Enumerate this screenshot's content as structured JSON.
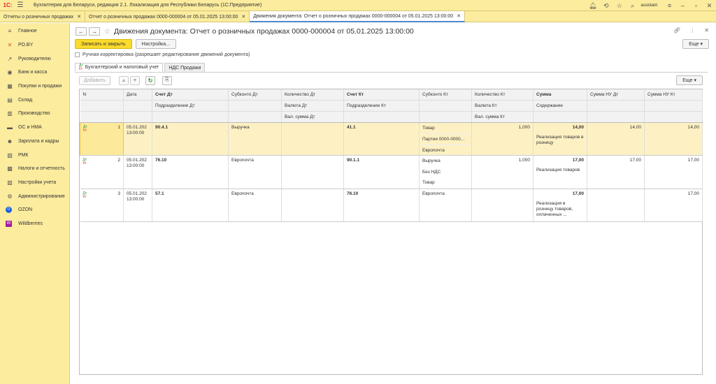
{
  "app": {
    "logo": "1С:",
    "title": "Бухгалтерия для Беларуси, редакция 2.1. Локализация для Республики Беларусь  (1С:Предприятие)",
    "user": "assistant"
  },
  "window_tabs": [
    {
      "label": "Отчеты о розничных продажах"
    },
    {
      "label": "Отчет о розничных продажах 0000-000004 от 05.01.2025 13:00:00"
    },
    {
      "label": "Движения документа: Отчет о розничных продажах 0000-000004 от 05.01.2025 13:00:00"
    }
  ],
  "sidebar": {
    "items": [
      {
        "label": "Главное",
        "icon": "≡"
      },
      {
        "label": "РО.BY",
        "icon": "✕"
      },
      {
        "label": "Руководителю",
        "icon": "↗"
      },
      {
        "label": "Банк и касса",
        "icon": "◉"
      },
      {
        "label": "Покупки и продажи",
        "icon": "▦"
      },
      {
        "label": "Склад",
        "icon": "▤"
      },
      {
        "label": "Производство",
        "icon": "▥"
      },
      {
        "label": "ОС и НМА",
        "icon": "▬"
      },
      {
        "label": "Зарплата и кадры",
        "icon": "☻"
      },
      {
        "label": "РМК",
        "icon": "▧"
      },
      {
        "label": "Налоги и отчетность",
        "icon": "▩"
      },
      {
        "label": "Настройки учета",
        "icon": "▨"
      },
      {
        "label": "Администрирование",
        "icon": "⚙"
      },
      {
        "label": "OZON",
        "icon": "O"
      },
      {
        "label": "Wildberries",
        "icon": "W"
      }
    ]
  },
  "main": {
    "title": "Движения документа: Отчет о розничных продажах 0000-000004 от 05.01.2025 13:00:00",
    "save_close": "Записать и закрыть",
    "settings": "Настройка...",
    "more": "Еще",
    "manual_edit": "Ручная корректировка (разрешает редактирование движений документа)",
    "tabs": [
      {
        "label": "Бухгалтерский и налоговый учет"
      },
      {
        "label": "НДС Продажи"
      }
    ],
    "add": "Добавить"
  },
  "grid": {
    "headers": {
      "n": "N",
      "date": "Дата",
      "acc_dt": "Счет Дт",
      "dept_dt": "Подразделение Дт",
      "subk_dt": "Субконто Дт",
      "qty_dt": "Количество Дт",
      "cur_dt": "Валюта Дт",
      "cursum_dt": "Вал. сумма Дт",
      "acc_kt": "Счет Кт",
      "dept_kt": "Подразделение Кт",
      "subk_kt": "Субконто Кт",
      "qty_kt": "Количество Кт",
      "cur_kt": "Валюта Кт",
      "cursum_kt": "Вал. сумма Кт",
      "sum": "Сумма",
      "content": "Содержание",
      "nu_dt": "Сумма НУ Дт",
      "nu_kt": "Сумма НУ Кт"
    },
    "rows": [
      {
        "n": "1",
        "date": "05.01.202",
        "time": "13:00:00",
        "acc_dt": "90.4.1",
        "subk_dt": [
          "Выручка"
        ],
        "acc_kt": "41.1",
        "subk_kt": [
          "Товар",
          "Партия 0000-0000...",
          "Европочта"
        ],
        "qty_kt": "1,000",
        "sum": "14,00",
        "content": "Реализация товаров в розницу",
        "nu_dt": "14,00",
        "nu_kt": "14,00"
      },
      {
        "n": "2",
        "date": "05.01.202",
        "time": "13:00:00",
        "acc_dt": "76.10",
        "subk_dt": [
          "Европочта"
        ],
        "acc_kt": "90.1.1",
        "subk_kt": [
          "Выручка",
          "Без НДС",
          "Товар"
        ],
        "qty_kt": "1,000",
        "sum": "17,00",
        "content": "Реализация товаров",
        "nu_dt": "17,00",
        "nu_kt": "17,00"
      },
      {
        "n": "3",
        "date": "05.01.202",
        "time": "13:00:00",
        "acc_dt": "57.1",
        "subk_dt": [
          "Европочта"
        ],
        "acc_kt": "76.10",
        "subk_kt": [
          "Европочта"
        ],
        "qty_kt": "",
        "sum": "17,00",
        "content": "Реализация в розницу товаров, оплаченных ...",
        "nu_dt": "",
        "nu_kt": "17,00"
      }
    ]
  }
}
